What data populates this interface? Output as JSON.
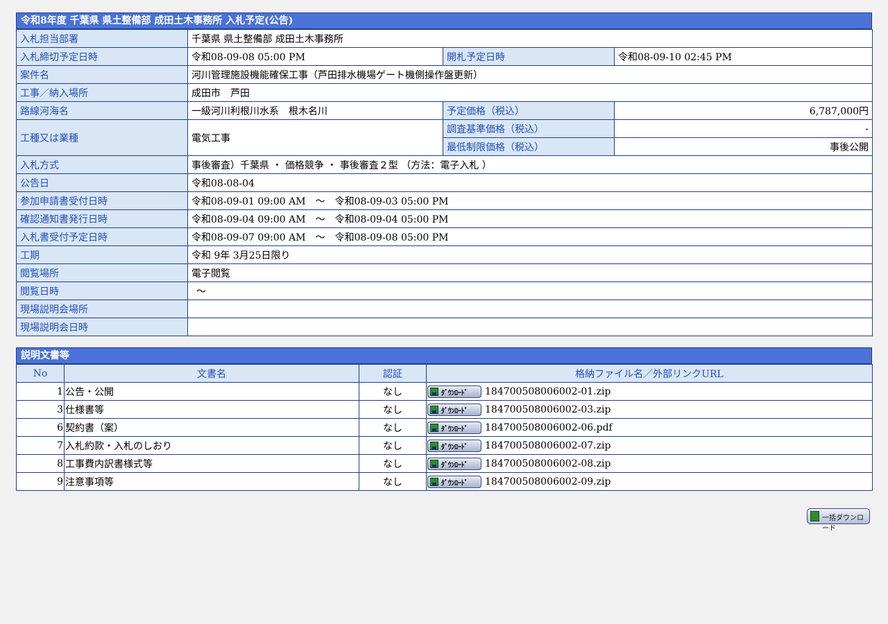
{
  "section1": {
    "title": "令和8年度 千葉県 県土整備部 成田土木事務所 入札予定(公告)",
    "dept_label": "入札担当部署",
    "dept_value": "千葉県 県土整備部 成田土木事務所",
    "deadline_label": "入札締切予定日時",
    "deadline_value": "令和08-09-08 05:00 PM",
    "opening_label": "開札予定日時",
    "opening_value": "令和08-09-10 02:45 PM",
    "project_label": "案件名",
    "project_value": "河川管理施設機能確保工事（芦田排水機場ゲート機側操作盤更新）",
    "place_label": "工事／納入場所",
    "place_value": "成田市　芦田",
    "route_label": "路線河海名",
    "route_value": "一級河川利根川水系　根木名川",
    "planned_price_label": "予定価格（税込）",
    "planned_price_value": "6,787,000円",
    "type_label": "工種又は業種",
    "type_value": "電気工事",
    "survey_price_label": "調査基準価格（税込）",
    "survey_price_value": "-",
    "min_price_label": "最低制限価格（税込）",
    "min_price_value": "事後公開",
    "method_label": "入札方式",
    "method_value": "事後審査）千葉県 ・ 価格競争 ・ 事後審査２型 （方法：電子入札 ）",
    "notice_label": "公告日",
    "notice_value": "令和08-08-04",
    "apply_label": "参加申請書受付日時",
    "apply_value": "令和08-09-01 09:00 AM　～　令和08-09-03 05:00 PM",
    "confirm_label": "確認通知書発行日時",
    "confirm_value": "令和08-09-04 09:00 AM　～　令和08-09-04 05:00 PM",
    "receive_label": "入札書受付予定日時",
    "receive_value": "令和08-09-07 09:00 AM　～　令和08-09-08 05:00 PM",
    "period_label": "工期",
    "period_value": "令和 9年 3月25日限り",
    "viewplace_label": "閲覧場所",
    "viewplace_value": "電子閲覧",
    "viewdate_label": "閲覧日時",
    "viewdate_value": "～",
    "site_place_label": "現場説明会場所",
    "site_place_value": "",
    "site_date_label": "現場説明会日時",
    "site_date_value": ""
  },
  "section2": {
    "title": "説明文書等",
    "col_no": "No",
    "col_name": "文書名",
    "col_auth": "認証",
    "col_file": "格納ファイル名／外部リンクURL",
    "download_label": "ﾀﾞｳﾝﾛｰﾄﾞ",
    "rows": [
      {
        "no": "1",
        "name": "公告・公開",
        "auth": "なし",
        "file": "184700508006002-01.zip"
      },
      {
        "no": "3",
        "name": "仕様書等",
        "auth": "なし",
        "file": "184700508006002-03.zip"
      },
      {
        "no": "6",
        "name": "契約書（案）",
        "auth": "なし",
        "file": "184700508006002-06.pdf"
      },
      {
        "no": "7",
        "name": "入札約款・入札のしおり",
        "auth": "なし",
        "file": "184700508006002-07.zip"
      },
      {
        "no": "8",
        "name": "工事費内訳書様式等",
        "auth": "なし",
        "file": "184700508006002-08.zip"
      },
      {
        "no": "9",
        "name": "注意事項等",
        "auth": "なし",
        "file": "184700508006002-09.zip"
      }
    ]
  },
  "bulk_download_label": "一括ダウンロード",
  "icons": {
    "download": "download-icon",
    "bulk": "bulk-download-icon"
  }
}
